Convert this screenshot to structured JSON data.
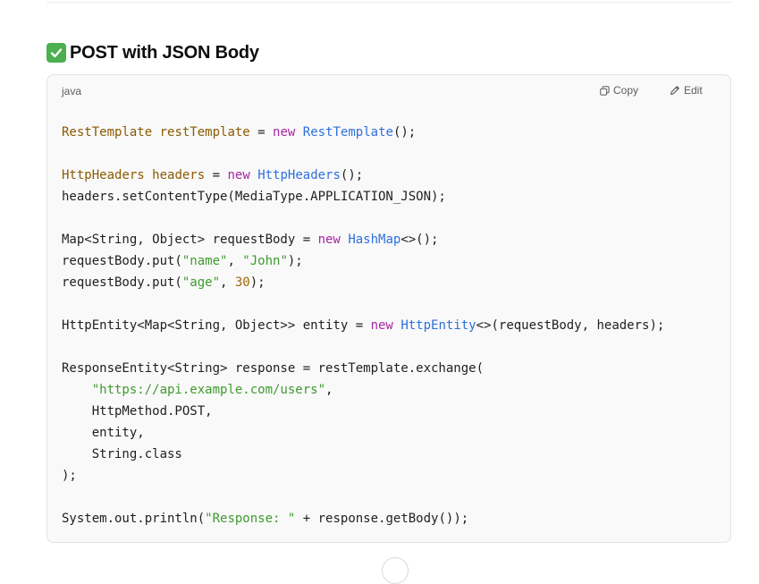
{
  "section": {
    "title": "POST with JSON Body",
    "icon": "check-mark-icon"
  },
  "code_block": {
    "language": "java",
    "copy_label": "Copy",
    "edit_label": "Edit",
    "lines": [
      [
        {
          "t": "RestTemplate",
          "c": "ty"
        },
        {
          "t": " "
        },
        {
          "t": "restTemplate",
          "c": "ty"
        },
        {
          "t": " = "
        },
        {
          "t": "new",
          "c": "kw"
        },
        {
          "t": " "
        },
        {
          "t": "RestTemplate",
          "c": "cl"
        },
        {
          "t": "();"
        }
      ],
      [],
      [
        {
          "t": "HttpHeaders",
          "c": "ty"
        },
        {
          "t": " "
        },
        {
          "t": "headers",
          "c": "ty"
        },
        {
          "t": " = "
        },
        {
          "t": "new",
          "c": "kw"
        },
        {
          "t": " "
        },
        {
          "t": "HttpHeaders",
          "c": "cl"
        },
        {
          "t": "();"
        }
      ],
      [
        {
          "t": "headers.setContentType(MediaType.APPLICATION_JSON);"
        }
      ],
      [],
      [
        {
          "t": "Map<String, Object> requestBody = "
        },
        {
          "t": "new",
          "c": "kw"
        },
        {
          "t": " "
        },
        {
          "t": "HashMap",
          "c": "cl"
        },
        {
          "t": "<>();"
        }
      ],
      [
        {
          "t": "requestBody.put("
        },
        {
          "t": "\"name\"",
          "c": "st"
        },
        {
          "t": ", "
        },
        {
          "t": "\"John\"",
          "c": "st"
        },
        {
          "t": ");"
        }
      ],
      [
        {
          "t": "requestBody.put("
        },
        {
          "t": "\"age\"",
          "c": "st"
        },
        {
          "t": ", "
        },
        {
          "t": "30",
          "c": "nu"
        },
        {
          "t": ");"
        }
      ],
      [],
      [
        {
          "t": "HttpEntity<Map<String, Object>> entity = "
        },
        {
          "t": "new",
          "c": "kw"
        },
        {
          "t": " "
        },
        {
          "t": "HttpEntity",
          "c": "cl"
        },
        {
          "t": "<>(requestBody, headers);"
        }
      ],
      [],
      [
        {
          "t": "ResponseEntity<String> response = restTemplate.exchange("
        }
      ],
      [
        {
          "t": "    "
        },
        {
          "t": "\"https://api.example.com/users\"",
          "c": "st"
        },
        {
          "t": ","
        }
      ],
      [
        {
          "t": "    HttpMethod.POST,"
        }
      ],
      [
        {
          "t": "    entity,"
        }
      ],
      [
        {
          "t": "    String.class"
        }
      ],
      [
        {
          "t": ");"
        }
      ],
      [],
      [
        {
          "t": "System.out.println("
        },
        {
          "t": "\"Response: \"",
          "c": "st"
        },
        {
          "t": " + response.getBody());"
        }
      ]
    ]
  },
  "colors": {
    "keyword": "#a626a4",
    "type": "#8a5a00",
    "class": "#2f6fde",
    "string": "#3e9a2e",
    "number": "#a0680a",
    "check_bg": "#4caf50"
  }
}
